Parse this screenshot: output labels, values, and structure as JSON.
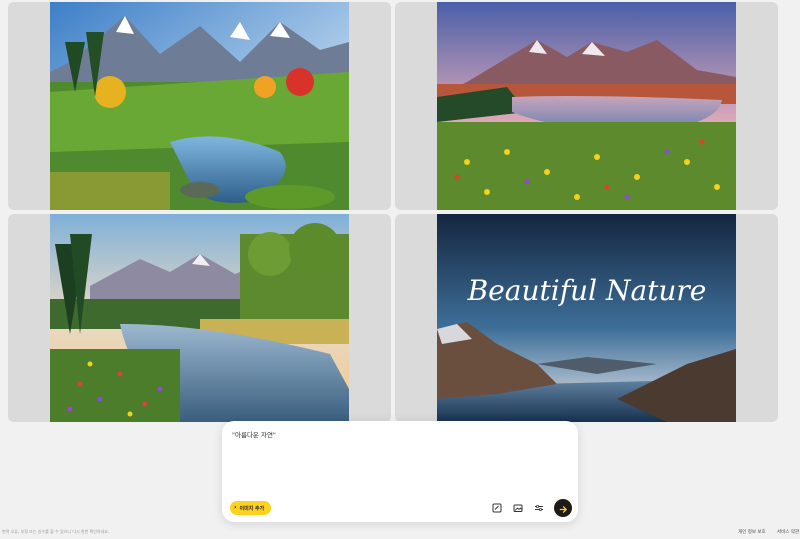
{
  "gallery": {
    "images": [
      {
        "name": "mountain-valley-river-autumn"
      },
      {
        "name": "sunset-lake-wildflowers"
      },
      {
        "name": "misty-river-forest"
      },
      {
        "name": "beautiful-nature-fjord",
        "overlay_text": "Beautiful Nature"
      }
    ]
  },
  "composer": {
    "prompt_value": "\"아름다운 자연\"",
    "add_image_label": "이미지 추가",
    "tools": [
      "aspect-ratio-icon",
      "image-style-icon",
      "settings-sliders-icon"
    ],
    "send_icon": "arrow-right-icon",
    "accent_color": "#ffd21f"
  },
  "footer": {
    "disclaimer": "번역 오류, 부정 또는 실수를 할 수 있으니 다시 한번 확인하세요.",
    "privacy_link": "개인 정보 보호",
    "terms_link": "서비스 약관"
  }
}
